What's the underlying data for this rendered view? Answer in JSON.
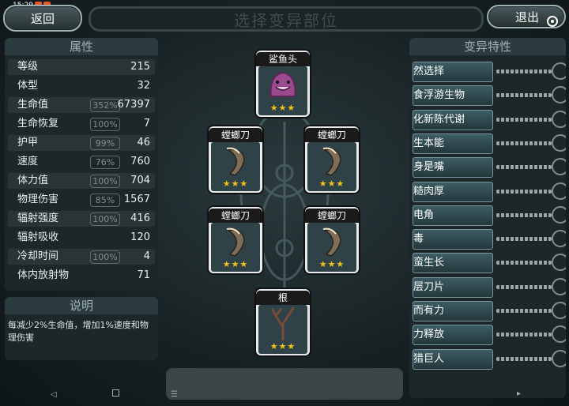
{
  "status": {
    "time": "15:29"
  },
  "top": {
    "back_label": "返回",
    "title": "选择变异部位",
    "exit_label": "退出"
  },
  "attributes": {
    "title": "属性",
    "rows": [
      {
        "name": "等级",
        "pct": "",
        "value": "215"
      },
      {
        "name": "体型",
        "pct": "",
        "value": "32"
      },
      {
        "name": "生命值",
        "pct": "352%",
        "value": "67397"
      },
      {
        "name": "生命恢复",
        "pct": "100%",
        "value": "7"
      },
      {
        "name": "护甲",
        "pct": "99%",
        "value": "46"
      },
      {
        "name": "速度",
        "pct": "76%",
        "value": "760"
      },
      {
        "name": "体力值",
        "pct": "100%",
        "value": "704"
      },
      {
        "name": "物理伤害",
        "pct": "85%",
        "value": "1567"
      },
      {
        "name": "辐射强度",
        "pct": "100%",
        "value": "416"
      },
      {
        "name": "辐射吸收",
        "pct": "",
        "value": "120"
      },
      {
        "name": "冷却时间",
        "pct": "100%",
        "value": "4"
      },
      {
        "name": "体内放射物",
        "pct": "",
        "value": "71"
      }
    ]
  },
  "description": {
    "title": "说明",
    "text": "每减少2%生命值，增加1%速度和物理伤害"
  },
  "traits": {
    "title": "变异特性",
    "items": [
      "然选择",
      "食浮游生物",
      "化新陈代谢",
      "生本能",
      "身是嘴",
      "糙肉厚",
      "电角",
      "毒",
      "蛮生长",
      "层刀片",
      "而有力",
      "力释放",
      "猎巨人"
    ]
  },
  "slots": {
    "head": {
      "label": "鲨鱼头",
      "stars": "★★★"
    },
    "left_top": {
      "label": "螳螂刀",
      "stars": "★★★"
    },
    "right_top": {
      "label": "螳螂刀",
      "stars": "★★★"
    },
    "left_bottom": {
      "label": "螳螂刀",
      "stars": "★★★"
    },
    "right_bottom": {
      "label": "螳螂刀",
      "stars": "★★★"
    },
    "root": {
      "label": "根",
      "stars": "★★★"
    }
  },
  "icons": [
    "back-arrow-icon",
    "target-icon",
    "shark-head-icon",
    "mantis-blade-icon",
    "root-icon",
    "menu-icon"
  ]
}
